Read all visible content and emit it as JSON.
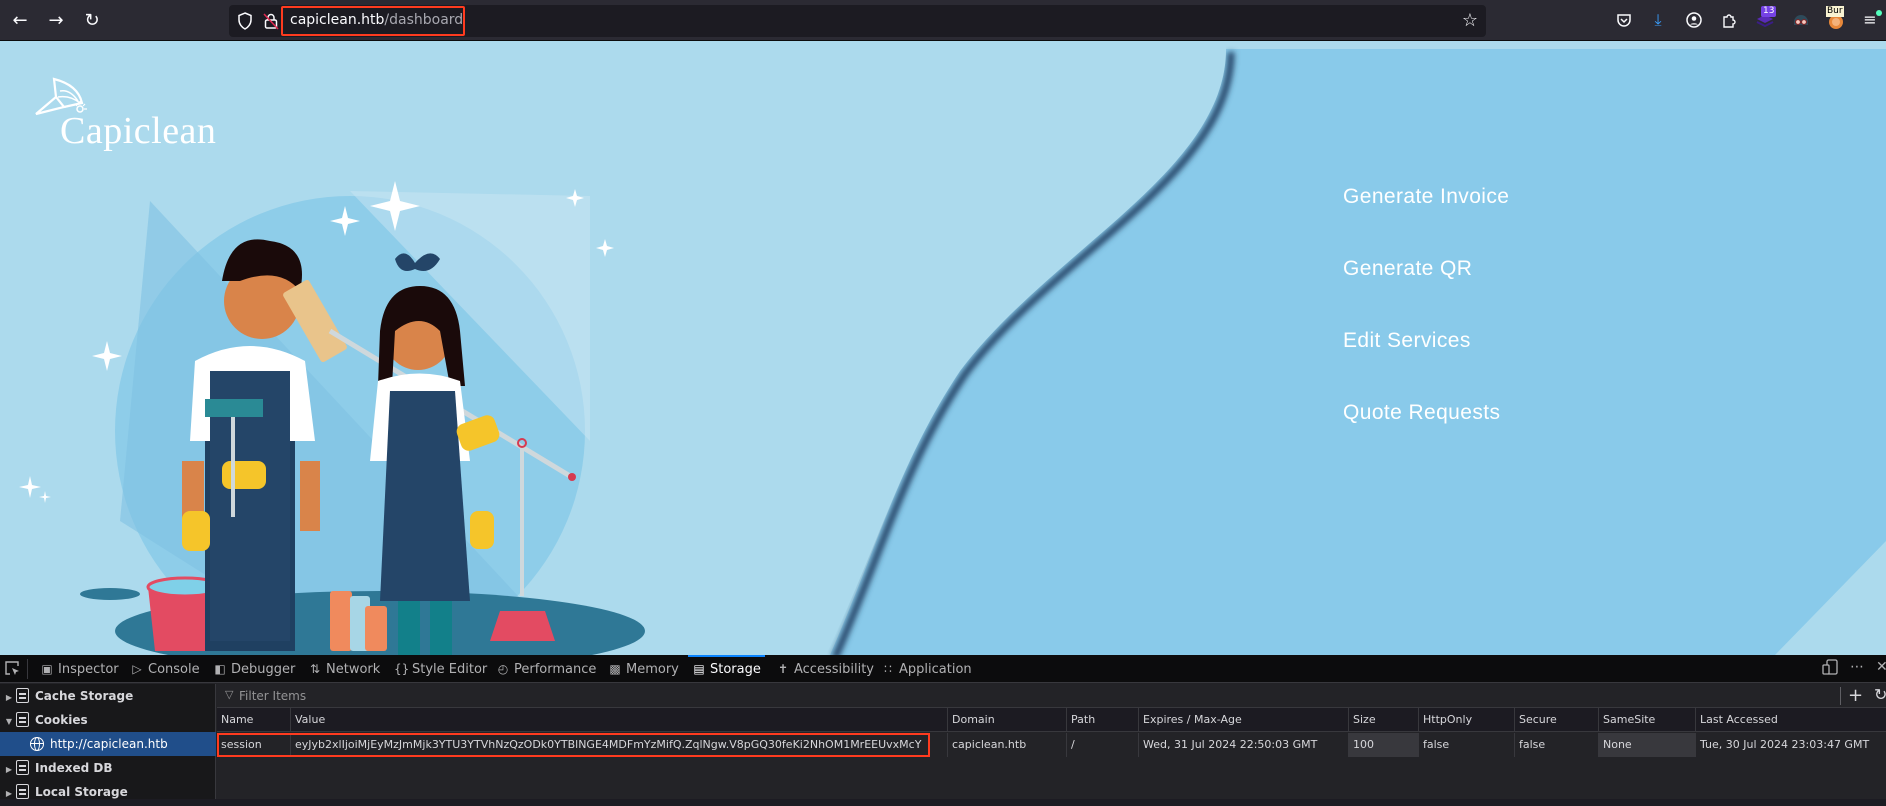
{
  "browser": {
    "url_host": "capiclean.htb",
    "url_path": "/dashboard",
    "extensions_badge_count": "13",
    "burp_label": "Bur",
    "icons": [
      "back-icon",
      "forward-icon",
      "reload-icon",
      "shield-icon",
      "insecure-lock-icon",
      "bookmark-star-icon",
      "pocket-icon",
      "downloads-icon",
      "account-icon",
      "extensions-icon",
      "ublock-extension-icon",
      "foxyproxy-icon",
      "burp-icon",
      "menu-icon"
    ]
  },
  "page": {
    "logo_text": "Capiclean",
    "colors": {
      "background_light": "#acdaed",
      "background_panel": "#89caea",
      "shadow": "#26466a"
    },
    "menu": [
      {
        "label": "Generate Invoice"
      },
      {
        "label": "Generate QR"
      },
      {
        "label": "Edit Services"
      },
      {
        "label": "Quote Requests"
      }
    ]
  },
  "devtools": {
    "tabs": [
      {
        "label": "Inspector",
        "icon": "inspector-icon"
      },
      {
        "label": "Console",
        "icon": "console-icon"
      },
      {
        "label": "Debugger",
        "icon": "debugger-icon"
      },
      {
        "label": "Network",
        "icon": "network-icon"
      },
      {
        "label": "Style Editor",
        "icon": "style-editor-icon"
      },
      {
        "label": "Performance",
        "icon": "performance-icon"
      },
      {
        "label": "Memory",
        "icon": "memory-icon"
      },
      {
        "label": "Storage",
        "icon": "storage-icon",
        "active": true
      },
      {
        "label": "Accessibility",
        "icon": "accessibility-icon"
      },
      {
        "label": "Application",
        "icon": "application-icon"
      }
    ],
    "sidebar": [
      {
        "label": "Cache Storage",
        "expanded": false
      },
      {
        "label": "Cookies",
        "expanded": true
      },
      {
        "label": "http://capiclean.htb",
        "child": true,
        "selected": true
      },
      {
        "label": "Indexed DB",
        "expanded": false
      },
      {
        "label": "Local Storage",
        "expanded": false
      }
    ],
    "filter_placeholder": "Filter Items",
    "columns": [
      "Name",
      "Value",
      "Domain",
      "Path",
      "Expires / Max-Age",
      "Size",
      "HttpOnly",
      "Secure",
      "SameSite",
      "Last Accessed"
    ],
    "rows": [
      {
        "name": "session",
        "value": "eyJyb2xlIjoiMjEyMzJmMjk3YTU3YTVhNzQzODk0YTBlNGE4MDFmYzMifQ.ZqlNgw.V8pGQ30feKi2NhOM1MrEEUvxMcY",
        "domain": "capiclean.htb",
        "path": "/",
        "expires": "Wed, 31 Jul 2024 22:50:03 GMT",
        "size": "100",
        "httponly": "false",
        "secure": "false",
        "samesite": "None",
        "last_accessed": "Tue, 30 Jul 2024 23:03:47 GMT"
      }
    ]
  }
}
